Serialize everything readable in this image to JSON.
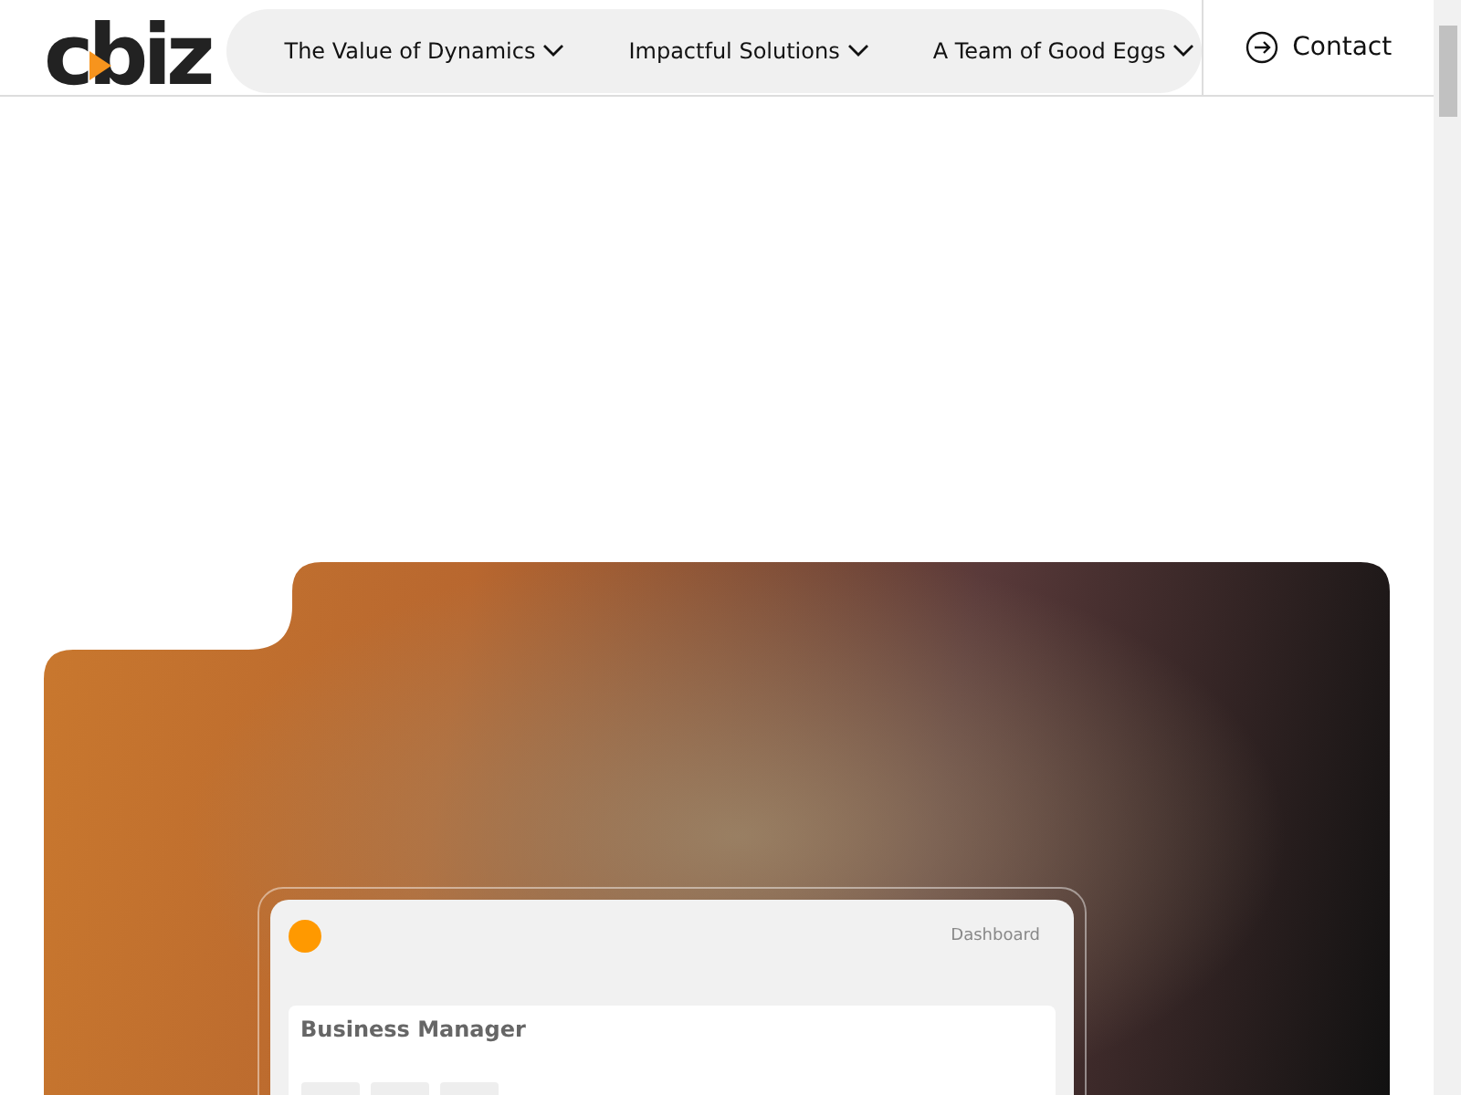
{
  "header": {
    "logo": "cbiz",
    "nav": [
      {
        "label": "The Value of Dynamics"
      },
      {
        "label": "Impactful Solutions"
      },
      {
        "label": "A Team of Good Eggs"
      }
    ],
    "contact": "Contact"
  },
  "hero": {
    "dashboard": {
      "link": "Dashboard",
      "card_title": "Business Manager"
    }
  }
}
